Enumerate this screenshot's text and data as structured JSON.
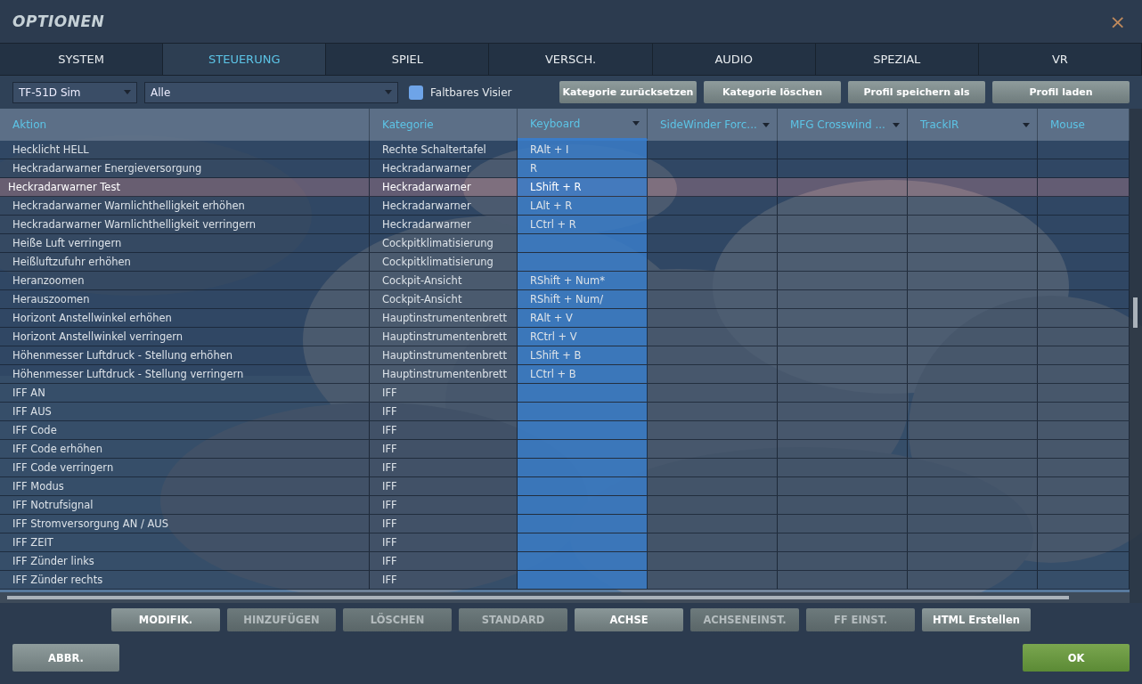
{
  "window": {
    "title": "OPTIONEN",
    "close": "×"
  },
  "tabs": [
    {
      "label": "SYSTEM",
      "selected": false
    },
    {
      "label": "STEUERUNG",
      "selected": true
    },
    {
      "label": "SPIEL",
      "selected": false
    },
    {
      "label": "VERSCH.",
      "selected": false
    },
    {
      "label": "AUDIO",
      "selected": false
    },
    {
      "label": "SPEZIAL",
      "selected": false
    },
    {
      "label": "VR",
      "selected": false
    }
  ],
  "toolbar": {
    "aircraft": "TF-51D Sim",
    "category": "Alle",
    "foldable_visor": {
      "label": "Faltbares Visier",
      "checked": false
    },
    "buttons": [
      "Kategorie zurücksetzen",
      "Kategorie löschen",
      "Profil speichern als",
      "Profil laden"
    ]
  },
  "table": {
    "columns": [
      {
        "label": "Aktion",
        "dropdown": false,
        "selected": false
      },
      {
        "label": "Kategorie",
        "dropdown": false,
        "selected": false
      },
      {
        "label": "Keyboard",
        "dropdown": true,
        "selected": true
      },
      {
        "label": "SideWinder Forc...",
        "dropdown": true,
        "selected": false
      },
      {
        "label": "MFG Crosswind ...",
        "dropdown": true,
        "selected": false
      },
      {
        "label": "TrackIR",
        "dropdown": true,
        "selected": false
      },
      {
        "label": "Mouse",
        "dropdown": false,
        "selected": false
      }
    ],
    "rows": [
      {
        "action": "Hecklicht HELL",
        "category": "Rechte Schaltertafel",
        "keyboard": "RAlt + I",
        "selected": false
      },
      {
        "action": "Heckradarwarner Energieversorgung",
        "category": "Heckradarwarner",
        "keyboard": "R",
        "selected": false
      },
      {
        "action": "Heckradarwarner Test",
        "category": "Heckradarwarner",
        "keyboard": "LShift + R",
        "selected": true
      },
      {
        "action": "Heckradarwarner Warnlichthelligkeit erhöhen",
        "category": "Heckradarwarner",
        "keyboard": "LAlt + R",
        "selected": false
      },
      {
        "action": "Heckradarwarner Warnlichthelligkeit verringern",
        "category": "Heckradarwarner",
        "keyboard": "LCtrl + R",
        "selected": false
      },
      {
        "action": "Heiße Luft verringern",
        "category": "Cockpitklimatisierung",
        "selected": false
      },
      {
        "action": "Heißluftzufuhr erhöhen",
        "category": "Cockpitklimatisierung",
        "selected": false
      },
      {
        "action": "Heranzoomen",
        "category": "Cockpit-Ansicht",
        "keyboard": "RShift + Num*",
        "selected": false
      },
      {
        "action": "Herauszoomen",
        "category": "Cockpit-Ansicht",
        "keyboard": "RShift + Num/",
        "selected": false
      },
      {
        "action": "Horizont Anstellwinkel erhöhen",
        "category": "Hauptinstrumentenbrett",
        "keyboard": "RAlt + V",
        "selected": false
      },
      {
        "action": "Horizont Anstellwinkel verringern",
        "category": "Hauptinstrumentenbrett",
        "keyboard": "RCtrl + V",
        "selected": false
      },
      {
        "action": "Höhenmesser Luftdruck - Stellung erhöhen",
        "category": "Hauptinstrumentenbrett",
        "keyboard": "LShift + B",
        "selected": false
      },
      {
        "action": "Höhenmesser Luftdruck - Stellung verringern",
        "category": "Hauptinstrumentenbrett",
        "keyboard": "LCtrl + B",
        "selected": false
      },
      {
        "action": "IFF AN",
        "category": "IFF",
        "selected": false
      },
      {
        "action": "IFF AUS",
        "category": "IFF",
        "selected": false
      },
      {
        "action": "IFF Code",
        "category": "IFF",
        "selected": false
      },
      {
        "action": "IFF Code erhöhen",
        "category": "IFF",
        "selected": false
      },
      {
        "action": "IFF Code verringern",
        "category": "IFF",
        "selected": false
      },
      {
        "action": "IFF Modus",
        "category": "IFF",
        "selected": false
      },
      {
        "action": "IFF Notrufsignal",
        "category": "IFF",
        "selected": false
      },
      {
        "action": "IFF Stromversorgung AN / AUS",
        "category": "IFF",
        "selected": false
      },
      {
        "action": "IFF ZEIT",
        "category": "IFF",
        "selected": false
      },
      {
        "action": "IFF Zünder links",
        "category": "IFF",
        "selected": false
      },
      {
        "action": "IFF Zünder rechts",
        "category": "IFF",
        "selected": false
      }
    ]
  },
  "actions": [
    {
      "label": "MODIFIK.",
      "disabled": false
    },
    {
      "label": "HINZUFÜGEN",
      "disabled": true
    },
    {
      "label": "LÖSCHEN",
      "disabled": true
    },
    {
      "label": "STANDARD",
      "disabled": true
    },
    {
      "label": "ACHSE",
      "disabled": false
    },
    {
      "label": "ACHSENEINST.",
      "disabled": true
    },
    {
      "label": "FF EINST.",
      "disabled": true
    },
    {
      "label": "HTML Erstellen",
      "disabled": false
    }
  ],
  "footer": {
    "cancel": "ABBR.",
    "ok": "OK"
  }
}
